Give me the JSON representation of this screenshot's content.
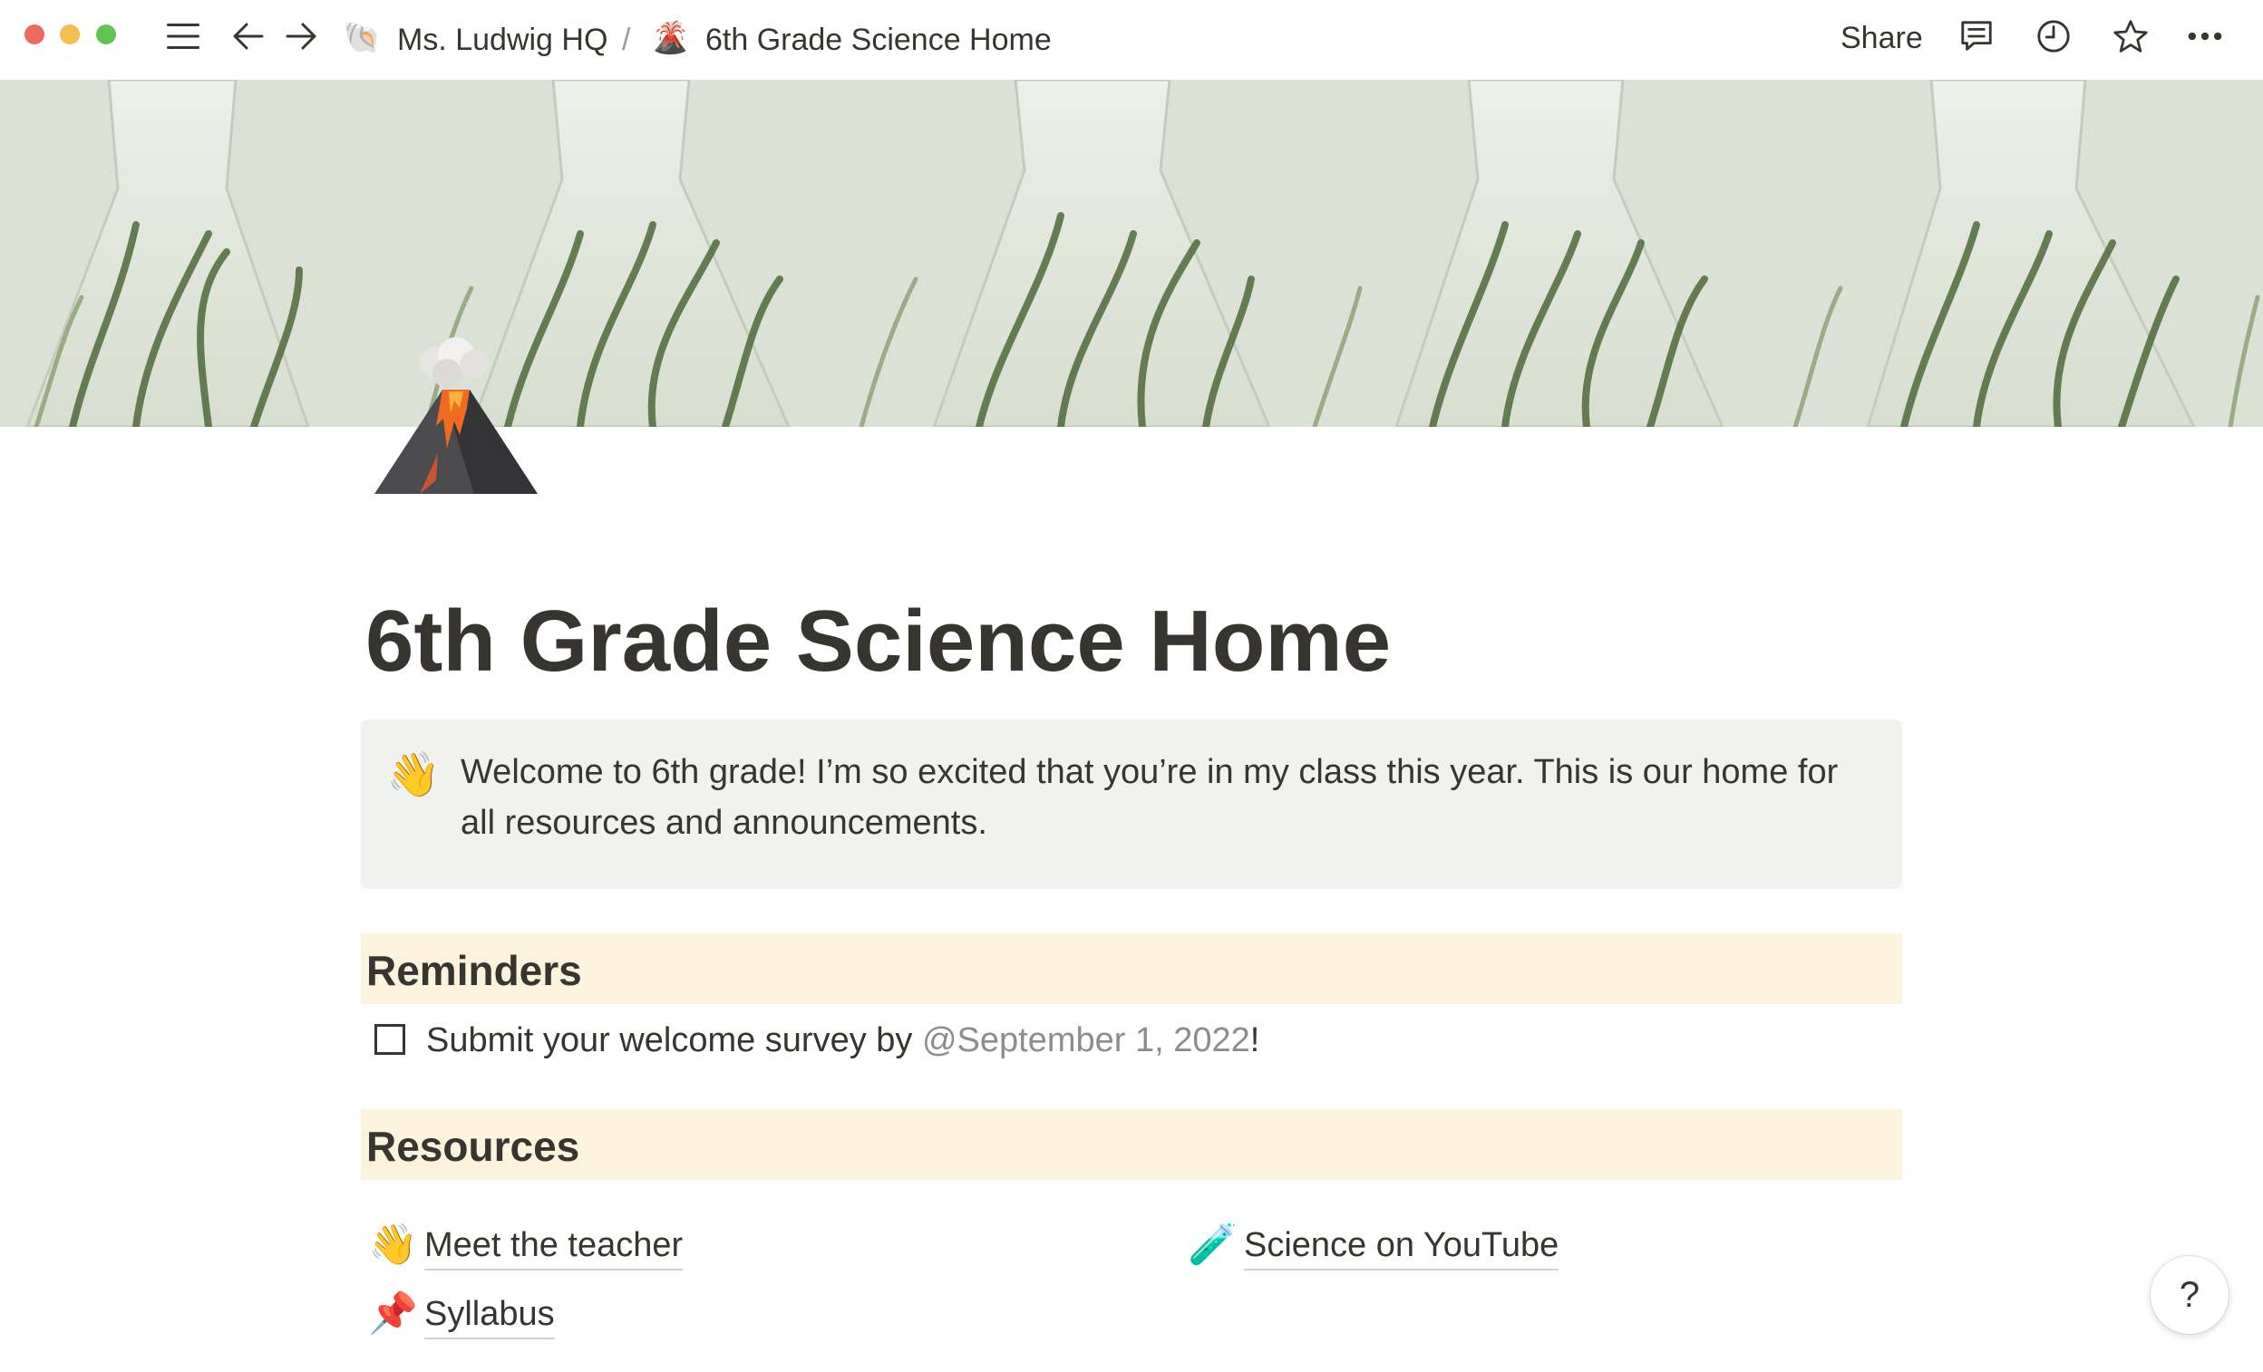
{
  "topbar": {
    "breadcrumb": [
      {
        "emoji": "🐚",
        "label": "Ms. Ludwig HQ"
      },
      {
        "emoji": "🌋",
        "label": "6th Grade Science Home"
      }
    ],
    "separator": "/",
    "share_label": "Share",
    "icons": [
      "menu-icon",
      "back-arrow-icon",
      "forward-arrow-icon",
      "comment-icon",
      "history-clock-icon",
      "star-icon",
      "more-icon"
    ]
  },
  "cover": {
    "description_icon": "cover-image"
  },
  "page": {
    "icon": "🌋",
    "title": "6th Grade Science Home",
    "callout": {
      "emoji": "👋",
      "text": "Welcome to 6th grade! I’m so excited that you’re in my class this year. This is our home for all resources and announcements."
    },
    "reminders": {
      "heading": "Reminders",
      "todos": [
        {
          "checked": false,
          "text_before": "Submit your welcome survey by ",
          "mention": "@September 1, 2022",
          "text_after": "!"
        }
      ]
    },
    "resources": {
      "heading": "Resources",
      "links": [
        {
          "emoji": "👋",
          "label": "Meet the teacher"
        },
        {
          "emoji": "🧪",
          "label": "Science on YouTube"
        },
        {
          "emoji": "📌",
          "label": "Syllabus"
        }
      ]
    }
  },
  "help": {
    "label": "?"
  },
  "colors": {
    "text": "#37352f",
    "callout_bg": "#f1f1ef",
    "heading_bg": "#fbf3db",
    "mention": "#8e8d8a"
  }
}
